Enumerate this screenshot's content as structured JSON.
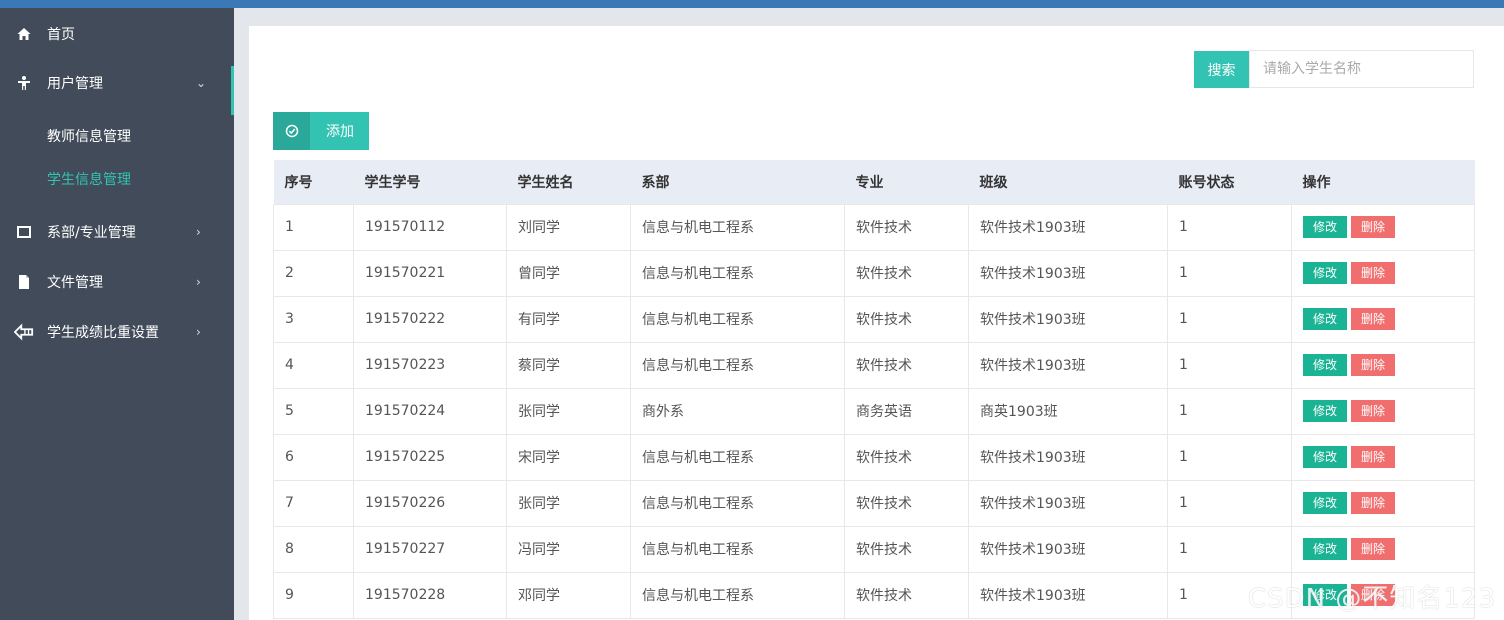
{
  "sidebar": {
    "items": [
      {
        "label": "首页",
        "icon": "home-icon"
      },
      {
        "label": "用户管理",
        "icon": "user-icon",
        "chevron": "⌄"
      },
      {
        "label": "系部/专业管理",
        "icon": "window-icon",
        "chevron": "›"
      },
      {
        "label": "文件管理",
        "icon": "file-icon",
        "chevron": "›"
      },
      {
        "label": "学生成绩比重设置",
        "icon": "scale-icon",
        "chevron": "›"
      }
    ],
    "sub_items": [
      {
        "label": "教师信息管理"
      },
      {
        "label": "学生信息管理"
      }
    ]
  },
  "search": {
    "button_label": "搜索",
    "placeholder": "请输入学生名称"
  },
  "toolbar": {
    "add_label": "添加"
  },
  "table": {
    "headers": [
      "序号",
      "学生学号",
      "学生姓名",
      "系部",
      "专业",
      "班级",
      "账号状态",
      "操作"
    ],
    "rows": [
      {
        "no": "1",
        "id": "191570112",
        "name": "刘同学",
        "dept": "信息与机电工程系",
        "major": "软件技术",
        "cls": "软件技术1903班",
        "status": "1"
      },
      {
        "no": "2",
        "id": "191570221",
        "name": "曾同学",
        "dept": "信息与机电工程系",
        "major": "软件技术",
        "cls": "软件技术1903班",
        "status": "1"
      },
      {
        "no": "3",
        "id": "191570222",
        "name": "有同学",
        "dept": "信息与机电工程系",
        "major": "软件技术",
        "cls": "软件技术1903班",
        "status": "1"
      },
      {
        "no": "4",
        "id": "191570223",
        "name": "蔡同学",
        "dept": "信息与机电工程系",
        "major": "软件技术",
        "cls": "软件技术1903班",
        "status": "1"
      },
      {
        "no": "5",
        "id": "191570224",
        "name": "张同学",
        "dept": "商外系",
        "major": "商务英语",
        "cls": "商英1903班",
        "status": "1"
      },
      {
        "no": "6",
        "id": "191570225",
        "name": "宋同学",
        "dept": "信息与机电工程系",
        "major": "软件技术",
        "cls": "软件技术1903班",
        "status": "1"
      },
      {
        "no": "7",
        "id": "191570226",
        "name": "张同学",
        "dept": "信息与机电工程系",
        "major": "软件技术",
        "cls": "软件技术1903班",
        "status": "1"
      },
      {
        "no": "8",
        "id": "191570227",
        "name": "冯同学",
        "dept": "信息与机电工程系",
        "major": "软件技术",
        "cls": "软件技术1903班",
        "status": "1"
      },
      {
        "no": "9",
        "id": "191570228",
        "name": "邓同学",
        "dept": "信息与机电工程系",
        "major": "软件技术",
        "cls": "软件技术1903班",
        "status": "1"
      }
    ],
    "edit_label": "修改",
    "delete_label": "删除"
  },
  "watermark": "CSDN @不知名123",
  "colors": {
    "sidebar_bg": "#424b59",
    "accent": "#33c3b3",
    "edit_button": "#1ab394",
    "delete_button": "#f06e6e",
    "table_header_bg": "#e8ecf5",
    "topbar": "#3a79b6"
  }
}
